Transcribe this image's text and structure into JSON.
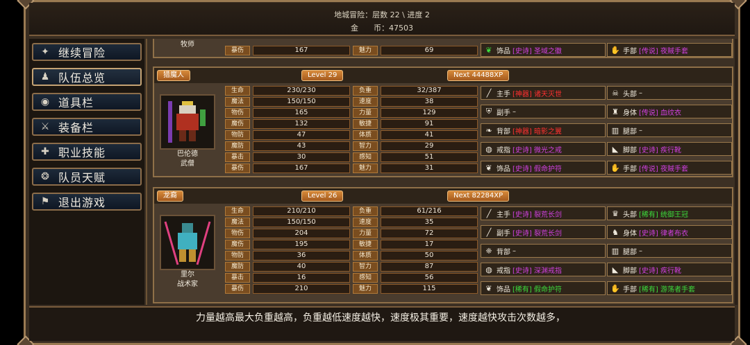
{
  "header": {
    "line1": "地城冒险：层数 22 \\ 进度 2",
    "line2": "金　　币：47503"
  },
  "menu": [
    {
      "label": "继续冒险",
      "icon": "dragon-icon"
    },
    {
      "label": "队伍总览",
      "icon": "party-icon"
    },
    {
      "label": "道具栏",
      "icon": "bag-icon"
    },
    {
      "label": "装备栏",
      "icon": "equipment-icon"
    },
    {
      "label": "职业技能",
      "icon": "skill-icon"
    },
    {
      "label": "队员天赋",
      "icon": "talent-icon"
    },
    {
      "label": "退出游戏",
      "icon": "flag-icon"
    }
  ],
  "card0": {
    "pname": "牧师",
    "stats": [
      {
        "l": "暴伤",
        "v": "167",
        "l2": "魅力",
        "v2": "69"
      }
    ],
    "slots": [
      {
        "pre": "饰品",
        "q": "[史诗] 圣域之徽",
        "qc": "epic",
        "icon": "amulet-icon"
      },
      {
        "pre": "手部",
        "q": "[传说] 夜賊手套",
        "qc": "legend",
        "icon": "glove-icon"
      }
    ]
  },
  "card1": {
    "class_tag": "猎魔人",
    "level": "Level 29",
    "next": "Next 44488XP",
    "name": "巴伦德",
    "job": "武僧",
    "stats": [
      {
        "l": "生命",
        "v": "230/230",
        "l2": "负重",
        "v2": "32/387"
      },
      {
        "l": "魔法",
        "v": "150/150",
        "l2": "速度",
        "v2": "38"
      },
      {
        "l": "物伤",
        "v": "165",
        "l2": "力量",
        "v2": "129"
      },
      {
        "l": "魔伤",
        "v": "132",
        "l2": "敏捷",
        "v2": "91"
      },
      {
        "l": "物防",
        "v": "47",
        "l2": "体质",
        "v2": "41"
      },
      {
        "l": "魔防",
        "v": "43",
        "l2": "智力",
        "v2": "29"
      },
      {
        "l": "暴击",
        "v": "30",
        "l2": "感知",
        "v2": "51"
      },
      {
        "l": "暴伤",
        "v": "167",
        "l2": "魅力",
        "v2": "31"
      }
    ],
    "slots": [
      {
        "pre": "主手",
        "q": "[神器] 诸天灭世",
        "qc": "red",
        "icon": "sword-icon"
      },
      {
        "pre": "头部",
        "q": "–",
        "qc": "",
        "icon": "skull-icon"
      },
      {
        "pre": "副手",
        "q": "–",
        "qc": "",
        "icon": "shield-icon"
      },
      {
        "pre": "身体",
        "q": "[传说] 血纹衣",
        "qc": "legend",
        "icon": "armor-icon"
      },
      {
        "pre": "背部",
        "q": "[神器] 暗影之翼",
        "qc": "red",
        "icon": "cloak-icon"
      },
      {
        "pre": "腿部",
        "q": "–",
        "qc": "",
        "icon": "legs-icon"
      },
      {
        "pre": "戒指",
        "q": "[史诗] 微光之戒",
        "qc": "epic",
        "icon": "ring-icon"
      },
      {
        "pre": "脚部",
        "q": "[史诗] 疾行靴",
        "qc": "epic",
        "icon": "boots-icon"
      },
      {
        "pre": "饰品",
        "q": "[史诗] 假命护符",
        "qc": "epic",
        "icon": "amulet-icon"
      },
      {
        "pre": "手部",
        "q": "[传说] 夜賊手套",
        "qc": "legend",
        "icon": "glove-icon"
      }
    ]
  },
  "card2": {
    "class_tag": "龙裔",
    "level": "Level 26",
    "next": "Next 82284XP",
    "name": "里尔",
    "job": "战术家",
    "stats": [
      {
        "l": "生命",
        "v": "210/210",
        "l2": "负重",
        "v2": "61/216"
      },
      {
        "l": "魔法",
        "v": "150/150",
        "l2": "速度",
        "v2": "35"
      },
      {
        "l": "物伤",
        "v": "204",
        "l2": "力量",
        "v2": "72"
      },
      {
        "l": "魔伤",
        "v": "195",
        "l2": "敏捷",
        "v2": "17"
      },
      {
        "l": "物防",
        "v": "36",
        "l2": "体质",
        "v2": "50"
      },
      {
        "l": "魔防",
        "v": "40",
        "l2": "智力",
        "v2": "87"
      },
      {
        "l": "暴击",
        "v": "16",
        "l2": "感知",
        "v2": "56"
      },
      {
        "l": "暴伤",
        "v": "210",
        "l2": "魅力",
        "v2": "115"
      }
    ],
    "slots": [
      {
        "pre": "主手",
        "q": "[史诗] 裂荒长剑",
        "qc": "epic",
        "icon": "sword-icon"
      },
      {
        "pre": "头部",
        "q": "[稀有] 统御王冠",
        "qc": "green",
        "icon": "crown-icon"
      },
      {
        "pre": "副手",
        "q": "[史诗] 裂荒长剑",
        "qc": "epic",
        "icon": "sword-icon"
      },
      {
        "pre": "身体",
        "q": "[史诗] 律者布衣",
        "qc": "epic",
        "icon": "robe-icon"
      },
      {
        "pre": "背部",
        "q": "–",
        "qc": "",
        "icon": "wings-icon"
      },
      {
        "pre": "腿部",
        "q": "–",
        "qc": "",
        "icon": "legs-icon"
      },
      {
        "pre": "戒指",
        "q": "[史诗] 深渊戒指",
        "qc": "epic",
        "icon": "ring-icon"
      },
      {
        "pre": "脚部",
        "q": "[史诗] 疾行靴",
        "qc": "epic",
        "icon": "boots-icon"
      },
      {
        "pre": "饰品",
        "q": "[稀有] 假命护符",
        "qc": "green",
        "icon": "amulet-icon"
      },
      {
        "pre": "手部",
        "q": "[稀有] 游荡者手套",
        "qc": "green",
        "icon": "glove-icon"
      }
    ]
  },
  "footer": {
    "tip": "力量越高最大负重越高，负重越低速度越快，速度极其重要，速度越快攻击次数越多，"
  }
}
